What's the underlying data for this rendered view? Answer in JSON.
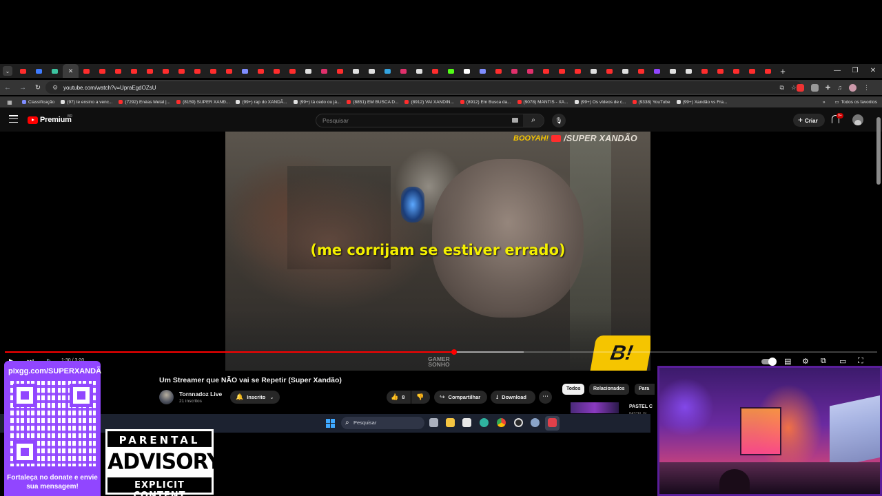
{
  "browser": {
    "url": "youtube.com/watch?v=UpraEgdOZsU",
    "tab_favicon_colors": [
      "#ff2d2d",
      "#3f7cff",
      "#3cc3a0",
      "#3cc3a0",
      "#ff2d2d",
      "#ff2d2d",
      "#ff2d2d",
      "#ff2d2d",
      "#ff2d2d",
      "#ff2d2d",
      "#ff2d2d",
      "#ff2d2d",
      "#ff2d2d",
      "#ff2d2d",
      "#7f8dff",
      "#ff2d2d",
      "#ff2d2d",
      "#ff2d2d",
      "#e0e0e0",
      "#e1306c",
      "#ff2d2d",
      "#e0e0e0",
      "#e0e0e0",
      "#34a4e0",
      "#e1306c",
      "#e0e0e0",
      "#ff2d2d",
      "#53fc18",
      "#ffffff",
      "#7f8dff",
      "#ff2d2d",
      "#e1306c",
      "#e1306c",
      "#ff2d2d",
      "#ff2d2d",
      "#ff2d2d",
      "#e0e0e0",
      "#ff2d2d",
      "#e0e0e0",
      "#ff2d2d",
      "#9146ff",
      "#e0e0e0",
      "#e0e0e0",
      "#ff2d2d",
      "#ff2d2d",
      "#ff2d2d",
      "#ff2d2d",
      "#ff2d2d"
    ],
    "bookmarks": [
      {
        "label": "Classificação",
        "color": "#7f8dff"
      },
      {
        "label": "(97) te ensino a venc...",
        "color": "#e0e0e0"
      },
      {
        "label": "(7292) Enéas Metal |...",
        "color": "#ff2d2d"
      },
      {
        "label": "(8159) SUPER XANĐ...",
        "color": "#ff2d2d"
      },
      {
        "label": "(99+) rap do XANDÃ...",
        "color": "#e0e0e0"
      },
      {
        "label": "(99+) tá cedo ou já...",
        "color": "#e0e0e0"
      },
      {
        "label": "(8851) EM BUSCA D...",
        "color": "#ff2d2d"
      },
      {
        "label": "(8912) VAI XANDIN...",
        "color": "#ff2d2d"
      },
      {
        "label": "(8912) Em Busca da...",
        "color": "#ff2d2d"
      },
      {
        "label": "(9078) MANTIS - XA...",
        "color": "#ff2d2d"
      },
      {
        "label": "(99+) Os vídeos de c...",
        "color": "#e0e0e0"
      },
      {
        "label": "(9338) YouTube",
        "color": "#ff2d2d"
      },
      {
        "label": "(99+) Xandão vs Fra...",
        "color": "#e0e0e0"
      }
    ],
    "all_bookmarks_label": "Todos os favoritos"
  },
  "youtube": {
    "logo_label": "Premium",
    "country_code": "BR",
    "search_placeholder": "Pesquisar",
    "create_label": "Criar",
    "notification_badge": "9+",
    "video": {
      "watermark_brand": "BOOYAH!",
      "watermark_channel": "/SUPER XANDÃO",
      "subtitle": "(me corrijam se estiver errado)",
      "logo_text": "B!",
      "gamer_logo": "GAMER SONHO",
      "time": "1:30 / 3:20",
      "progress_played": 0.515,
      "progress_buffered": 0.595
    },
    "title": "Um Streamer que NÃO vai se Repetir (Super Xandão)",
    "channel": "Tornnadoz Live",
    "subscribers": "21 inscritos",
    "subscribe_label": "Inscrito",
    "likes": "8",
    "share_label": "Compartilhar",
    "download_label": "Download",
    "chips": [
      "Todos",
      "Relacionados",
      "Para"
    ],
    "next_video_title": "PASTEL C",
    "next_video_sub": "PASTEL GI"
  },
  "taskbar": {
    "search_placeholder": "Pesquisar"
  },
  "overlay": {
    "donate_url": "pixgg.com/SUPERXANDÃ",
    "donate_text": "Fortaleça no donate e envie sua mensagem!",
    "advisory_top": "PARENTAL",
    "advisory_mid": "ADVISORY",
    "advisory_bottom": "EXPLICIT CONTENT"
  }
}
